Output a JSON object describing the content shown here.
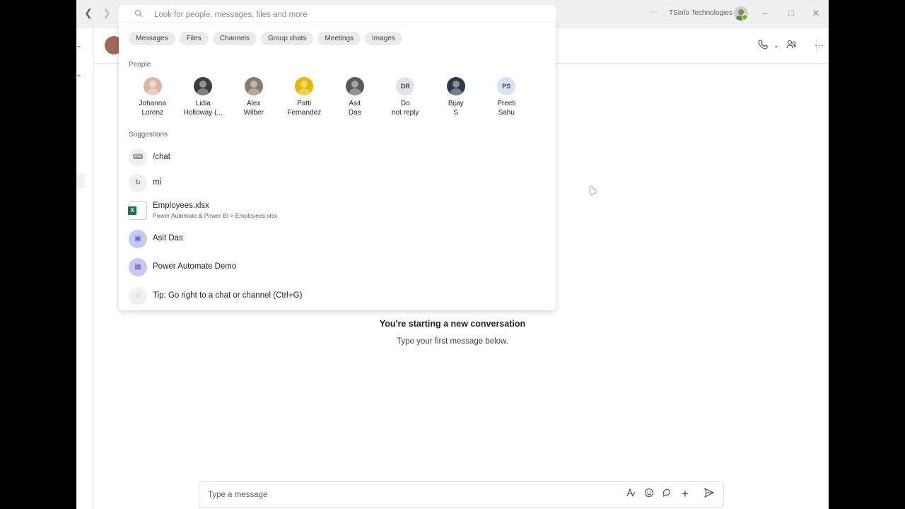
{
  "titlebar": {
    "org_name": "TSinfo Technologies",
    "more": "···"
  },
  "search": {
    "placeholder": "Look for people, messages, files and more",
    "filters": [
      "Messages",
      "Files",
      "Channels",
      "Group chats",
      "Meetings",
      "Images"
    ],
    "people_label": "People",
    "people": [
      {
        "name": "Johanna\nLorenz",
        "initials": "",
        "color": "#d9b7a6"
      },
      {
        "name": "Lidia\nHolloway (...",
        "initials": "",
        "color": "#3c3c3c"
      },
      {
        "name": "Alex\nWilber",
        "initials": "",
        "color": "#8a7a6c"
      },
      {
        "name": "Patti\nFernandez",
        "initials": "",
        "color": "#e6b800"
      },
      {
        "name": "Asit\nDas",
        "initials": "",
        "color": "#5a5a5a"
      },
      {
        "name": "Do\nnot reply",
        "initials": "DR",
        "color": "#e1e3e8"
      },
      {
        "name": "Bijay\nS",
        "initials": "",
        "color": "#2b3a4a"
      },
      {
        "name": "Preeti\nSahu",
        "initials": "PS",
        "color": "#d6e2f5"
      }
    ],
    "suggestions_label": "Suggestions",
    "suggestions": [
      {
        "icon": "keyboard-icon",
        "text": "/chat"
      },
      {
        "icon": "history-icon",
        "text": "mi"
      },
      {
        "icon": "excel-icon",
        "text": "Employees.xlsx",
        "sub": "Power Automate & Power BI > Employees.xlsx"
      },
      {
        "icon": "chat-icon",
        "text": "Asit Das"
      },
      {
        "icon": "calendar-icon",
        "text": "Power Automate Demo"
      },
      {
        "icon": "lightbulb-icon",
        "text": "Tip: Go right to a chat or channel (Ctrl+G)"
      }
    ]
  },
  "conversation": {
    "title": "You're starting a new conversation",
    "subtitle": "Type your first message below."
  },
  "composer": {
    "placeholder": "Type a message"
  },
  "colors": {
    "accent": "#5b5fc7",
    "excel": "#1e7145",
    "presence": "#6bb700"
  }
}
